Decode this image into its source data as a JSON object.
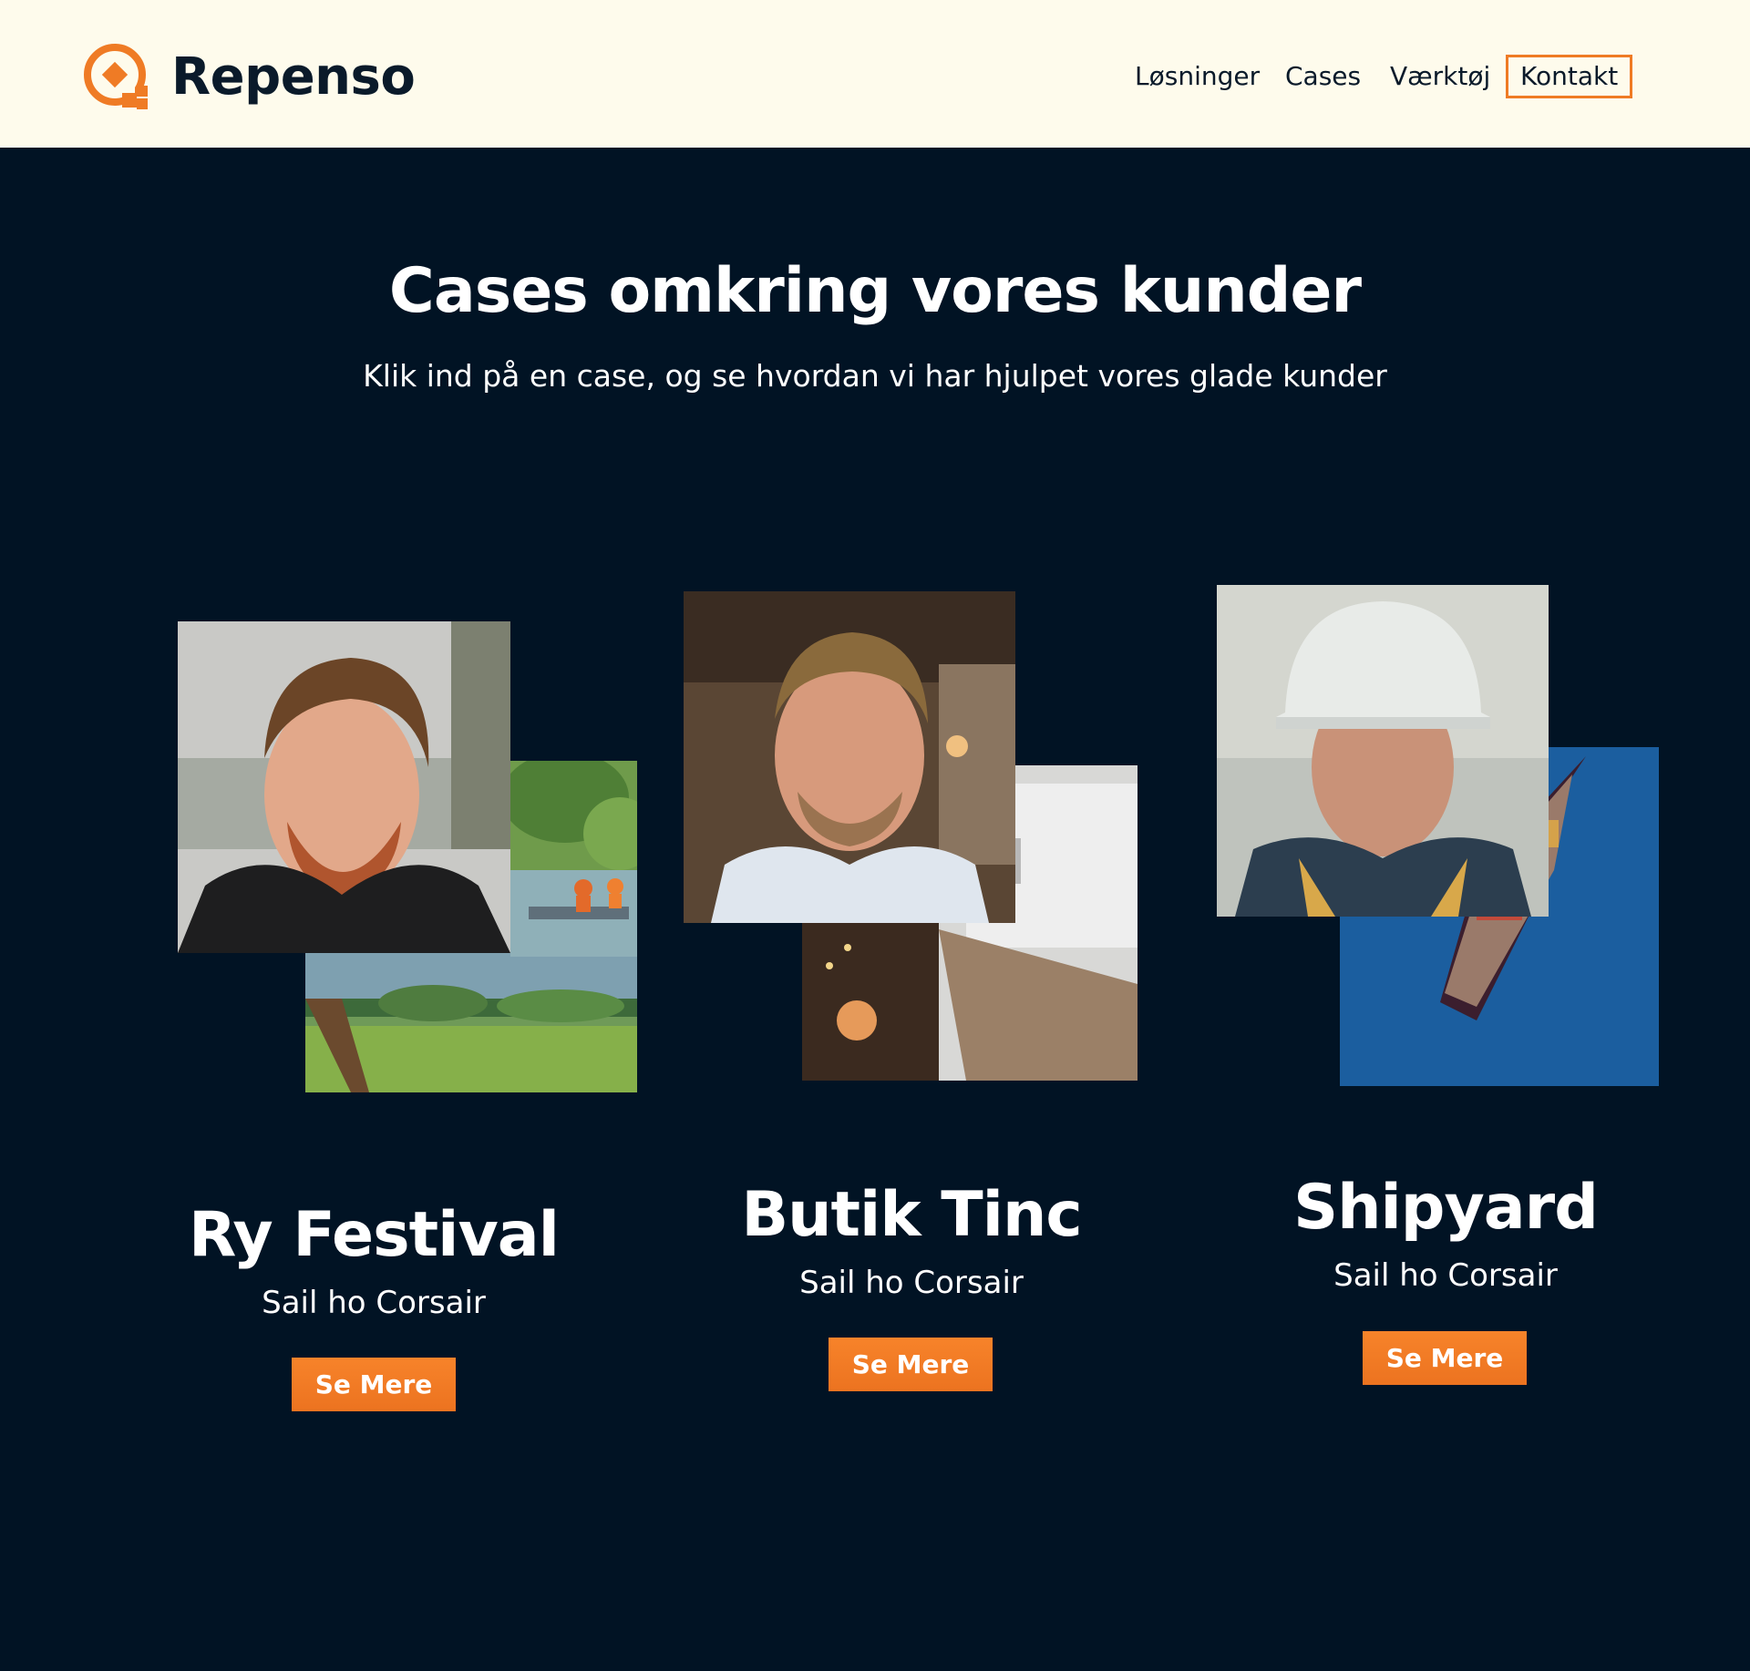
{
  "brand": {
    "name": "Repenso",
    "accent_color": "#ef7b25",
    "dark_color": "#011324",
    "header_bg": "#fefbec"
  },
  "nav": {
    "items": [
      {
        "label": "Løsninger"
      },
      {
        "label": "Cases"
      },
      {
        "label": "Værktøj"
      },
      {
        "label": "Kontakt"
      }
    ]
  },
  "hero": {
    "title": "Cases omkring vores kunder",
    "subtitle": "Klik ind på en case, og se hvordan vi har hjulpet vores glade kunder"
  },
  "cases": [
    {
      "name": "Ry Festival",
      "subtitle": "Sail ho Corsair",
      "button": "Se Mere"
    },
    {
      "name": "Butik Tinc",
      "subtitle": "Sail ho Corsair",
      "button": "Se Mere"
    },
    {
      "name": "Shipyard",
      "subtitle": "Sail ho Corsair",
      "button": "Se Mere"
    }
  ]
}
